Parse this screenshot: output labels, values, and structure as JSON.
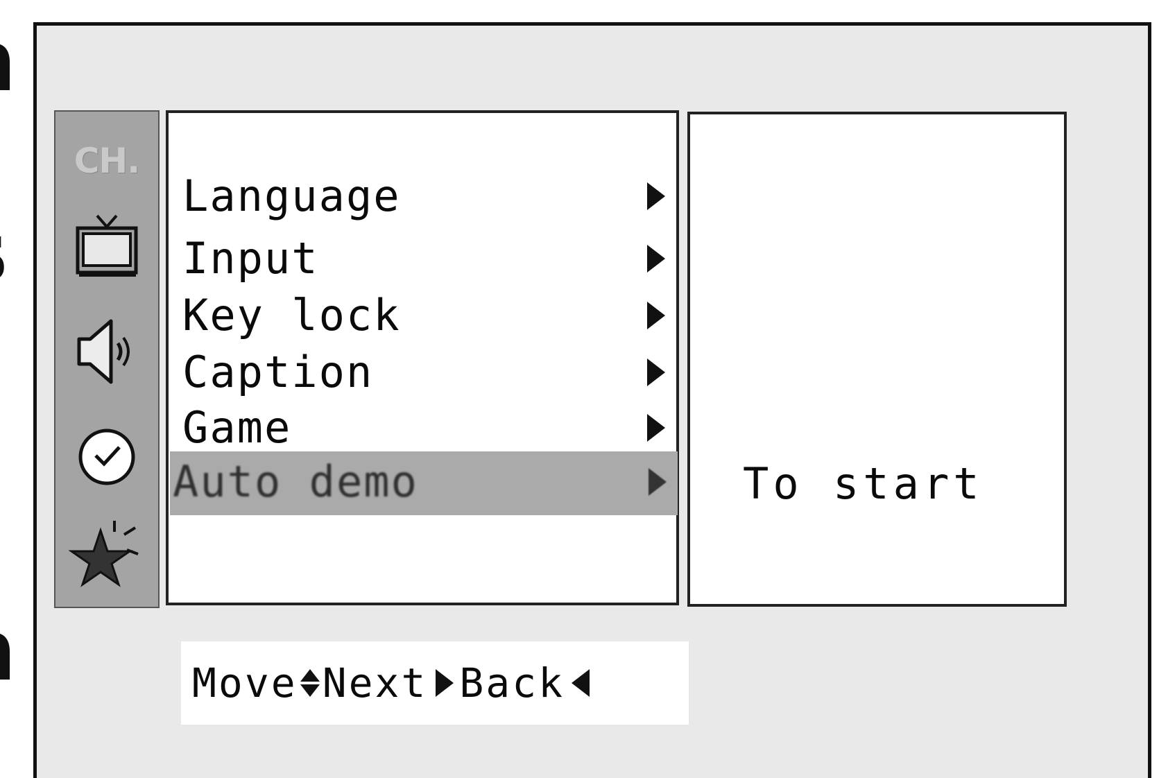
{
  "page_fragments": [
    "n",
    "s",
    "n"
  ],
  "sidebar": {
    "items": [
      {
        "name": "channel",
        "label": "CH.",
        "icon": "ch-icon"
      },
      {
        "name": "picture",
        "icon": "tv-icon"
      },
      {
        "name": "sound",
        "icon": "speaker-icon"
      },
      {
        "name": "time",
        "icon": "clock-icon"
      },
      {
        "name": "special",
        "icon": "star-icon"
      }
    ]
  },
  "menu": {
    "items": [
      {
        "label": "Language"
      },
      {
        "label": "Input"
      },
      {
        "label": "Key lock"
      },
      {
        "label": "Caption"
      },
      {
        "label": "Game"
      },
      {
        "label": "Auto demo"
      }
    ],
    "selected_index": 5
  },
  "description": {
    "text": "To start"
  },
  "help_bar": {
    "move": "Move",
    "next": "Next",
    "back": "Back"
  },
  "colors": {
    "osd_background": "#e9e9e9",
    "sidebar": "#a4a4a4",
    "selection": "#aaaaaa"
  }
}
